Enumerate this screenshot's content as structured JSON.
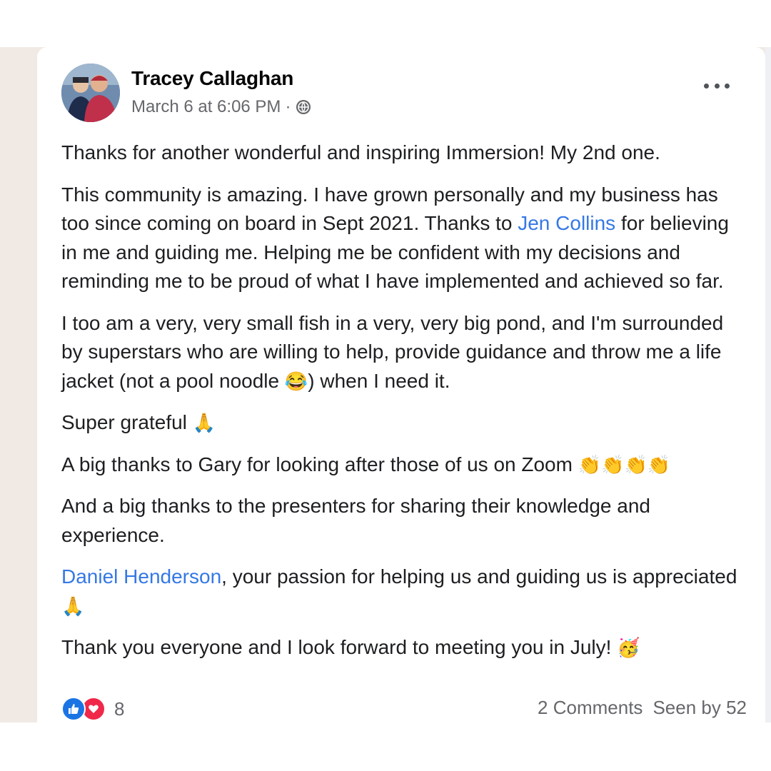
{
  "post": {
    "author": "Tracey Callaghan",
    "timestamp": "March 6 at 6:06 PM",
    "separator": "·",
    "privacy_icon": "globe-icon",
    "menu_icon": "more-options-icon",
    "paragraphs": {
      "p1": "Thanks for another wonderful and inspiring Immersion!  My 2nd one.",
      "p2_before": "This community is amazing. I have grown personally and my business has too since coming on board in Sept 2021. Thanks to ",
      "p2_mention": "Jen Collins",
      "p2_after": " for believing in me and guiding me. Helping me be confident with my decisions and reminding me to be proud of what I have implemented and achieved so far.",
      "p3_before": "I too am a very, very small fish in a very, very big pond, and I'm surrounded by superstars who are willing to help, provide guidance and throw me a life jacket (not a pool noodle ",
      "p3_emoji": "😂",
      "p3_after": ") when I need it.",
      "p4": "Super grateful ",
      "p4_emoji": "🙏",
      "p5": "A big thanks to Gary for looking after those of us on Zoom ",
      "p5_emoji": "👏👏👏👏",
      "p6": "And a big thanks to the presenters for sharing their knowledge and experience.",
      "p7_mention": "Daniel Henderson",
      "p7_after": ", your passion for helping us and guiding us is appreciated ",
      "p7_emoji": "🙏",
      "p8": "Thank you everyone and I look forward to meeting you in July! ",
      "p8_emoji": "🥳"
    },
    "footer": {
      "reaction_icons": [
        "like-icon",
        "love-icon"
      ],
      "reaction_count": "8",
      "comments": "2 Comments",
      "seen": "Seen by 52"
    },
    "colors": {
      "mention": "#3578e5",
      "like": "#1b74e4",
      "love": "#f0284a",
      "meta": "#65676b"
    }
  }
}
